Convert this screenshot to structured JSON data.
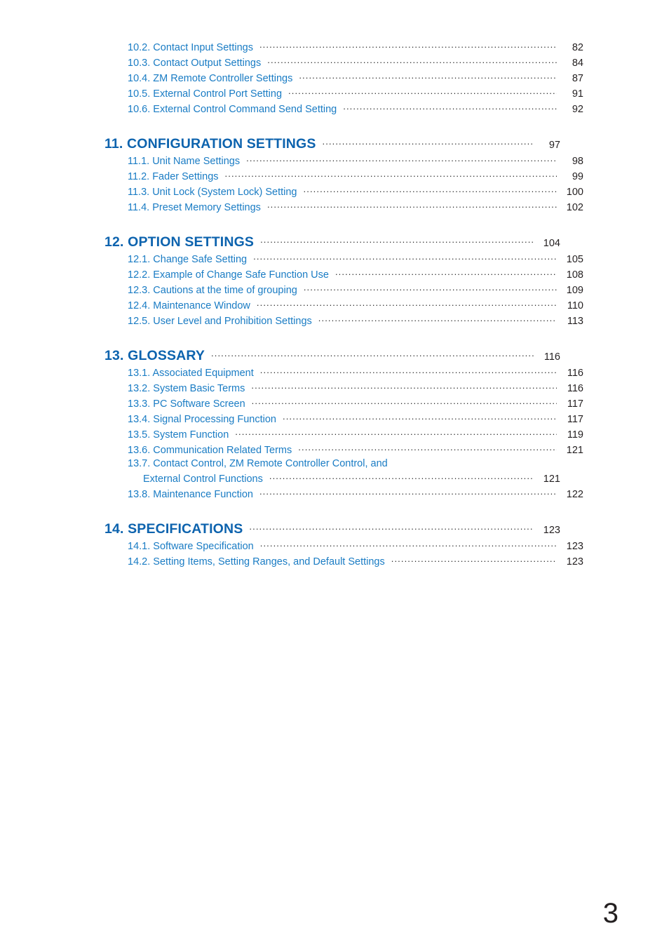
{
  "document": {
    "page_number": "3",
    "colors": {
      "chapter_blue": "#0d63ae",
      "section_blue": "#1a7cc4",
      "leader_and_pageno": "#231f20",
      "background": "#ffffff"
    }
  },
  "toc": {
    "groups": [
      {
        "id": "group-10",
        "spaced_above": false,
        "entries": [
          {
            "level": "section",
            "number": "10.2.",
            "label": "10.2. Contact Input Settings",
            "page": "82"
          },
          {
            "level": "section",
            "number": "10.3.",
            "label": "10.3. Contact Output Settings",
            "page": "84"
          },
          {
            "level": "section",
            "number": "10.4.",
            "label": "10.4. ZM Remote Controller Settings",
            "page": "87"
          },
          {
            "level": "section",
            "number": "10.5.",
            "label": "10.5. External Control Port Setting",
            "page": "91"
          },
          {
            "level": "section",
            "number": "10.6.",
            "label": "10.6. External Control Command Send Setting",
            "page": "92"
          }
        ]
      },
      {
        "id": "group-11",
        "spaced_above": true,
        "entries": [
          {
            "level": "chapter",
            "number": "11.",
            "label": "11. CONFIGURATION SETTINGS",
            "page": "97"
          },
          {
            "level": "section",
            "number": "11.1.",
            "label": "11.1. Unit Name Settings",
            "page": "98"
          },
          {
            "level": "section",
            "number": "11.2.",
            "label": "11.2. Fader Settings",
            "page": "99"
          },
          {
            "level": "section",
            "number": "11.3.",
            "label": "11.3. Unit Lock (System Lock) Setting",
            "page": "100"
          },
          {
            "level": "section",
            "number": "11.4.",
            "label": "11.4. Preset Memory Settings",
            "page": "102"
          }
        ]
      },
      {
        "id": "group-12",
        "spaced_above": true,
        "entries": [
          {
            "level": "chapter",
            "number": "12.",
            "label": "12. OPTION SETTINGS",
            "page": "104"
          },
          {
            "level": "section",
            "number": "12.1.",
            "label": "12.1. Change Safe Setting",
            "page": "105"
          },
          {
            "level": "section",
            "number": "12.2.",
            "label": "12.2. Example of Change Safe Function Use",
            "page": "108"
          },
          {
            "level": "section",
            "number": "12.3.",
            "label": "12.3. Cautions at the time of grouping",
            "page": "109"
          },
          {
            "level": "section",
            "number": "12.4.",
            "label": "12.4. Maintenance Window",
            "page": "110"
          },
          {
            "level": "section",
            "number": "12.5.",
            "label": "12.5. User Level and Prohibition Settings",
            "page": "113"
          }
        ]
      },
      {
        "id": "group-13",
        "spaced_above": true,
        "entries": [
          {
            "level": "chapter",
            "number": "13.",
            "label": "13. GLOSSARY",
            "page": "116"
          },
          {
            "level": "section",
            "number": "13.1.",
            "label": "13.1. Associated Equipment",
            "page": "116"
          },
          {
            "level": "section",
            "number": "13.2.",
            "label": "13.2. System Basic Terms",
            "page": "116"
          },
          {
            "level": "section",
            "number": "13.3.",
            "label": "13.3. PC Software Screen",
            "page": "117"
          },
          {
            "level": "section",
            "number": "13.4.",
            "label": "13.4. Signal Processing Function",
            "page": "117"
          },
          {
            "level": "section",
            "number": "13.5.",
            "label": "13.5. System Function",
            "page": "119"
          },
          {
            "level": "section",
            "number": "13.6.",
            "label": "13.6. Communication Related Terms",
            "page": "121"
          },
          {
            "level": "section-wrapped",
            "number": "13.7.",
            "label_line1": "13.7. Contact Control, ZM Remote Controller Control, and",
            "label_line2": "External Control Functions",
            "page": "121"
          },
          {
            "level": "section",
            "number": "13.8.",
            "label": "13.8. Maintenance Function",
            "page": "122"
          }
        ]
      },
      {
        "id": "group-14",
        "spaced_above": true,
        "entries": [
          {
            "level": "chapter",
            "number": "14.",
            "label": "14. SPECIFICATIONS",
            "page": "123"
          },
          {
            "level": "section",
            "number": "14.1.",
            "label": "14.1. Software Specification",
            "page": "123"
          },
          {
            "level": "section",
            "number": "14.2.",
            "label": "14.2. Setting Items, Setting Ranges, and Default Settings",
            "page": "123"
          }
        ]
      }
    ]
  }
}
